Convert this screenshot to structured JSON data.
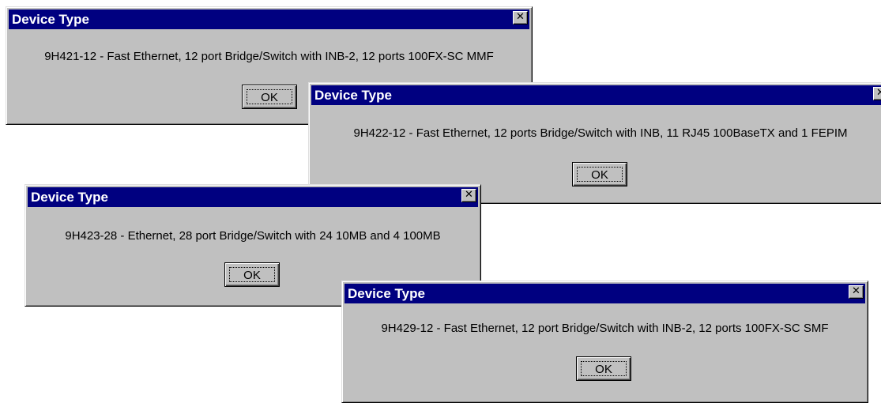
{
  "dialogs": [
    {
      "title": "Device Type",
      "message": "9H421-12 - Fast Ethernet, 12 port Bridge/Switch with INB-2, 12 ports 100FX-SC MMF",
      "ok_label": "OK",
      "close_label": "✕"
    },
    {
      "title": "Device Type",
      "message": "9H422-12 - Fast Ethernet, 12 ports Bridge/Switch with INB, 11 RJ45 100BaseTX and 1 FEPIM",
      "ok_label": "OK",
      "close_label": "✕"
    },
    {
      "title": "Device Type",
      "message": "9H423-28 - Ethernet, 28 port Bridge/Switch with 24 10MB and 4 100MB",
      "ok_label": "OK",
      "close_label": "✕"
    },
    {
      "title": "Device Type",
      "message": "9H429-12 - Fast Ethernet, 12 port Bridge/Switch with INB-2, 12 ports 100FX-SC SMF",
      "ok_label": "OK",
      "close_label": "✕"
    }
  ],
  "colors": {
    "titlebar": "#000080",
    "dialog_face": "#c0c0c0",
    "background": "#ffffff"
  },
  "icons": {
    "close": "close-icon"
  }
}
